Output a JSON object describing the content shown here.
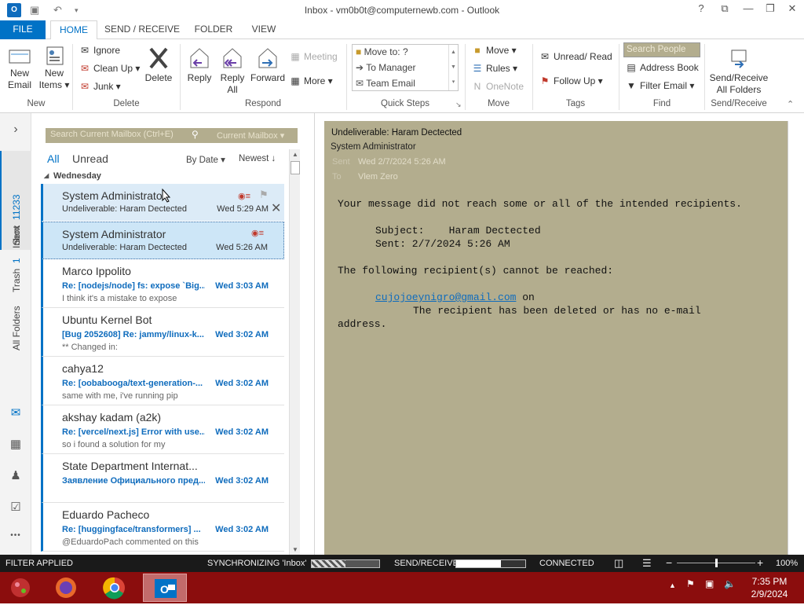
{
  "window": {
    "title": "Inbox - vm0b0t@computernewb.com - Outlook",
    "app_icon_label": "O",
    "controls": [
      "?",
      "⧉",
      "—",
      "❐",
      "✕"
    ]
  },
  "tabs": {
    "file": "FILE",
    "home": "HOME",
    "send_receive": "SEND / RECEIVE",
    "folder": "FOLDER",
    "view": "VIEW"
  },
  "ribbon": {
    "new": {
      "new_email_l1": "New",
      "new_email_l2": "Email",
      "new_items_l1": "New",
      "new_items_l2": "Items ▾",
      "label": "New"
    },
    "delete": {
      "ignore": "Ignore",
      "clean_up": "Clean Up ▾",
      "junk": "Junk ▾",
      "delete": "Delete",
      "label": "Delete"
    },
    "respond": {
      "reply": "Reply",
      "reply_all_l1": "Reply",
      "reply_all_l2": "All",
      "forward": "Forward",
      "meeting": "Meeting",
      "more": "More ▾",
      "label": "Respond"
    },
    "quick_steps": {
      "items": [
        "Move to: ?",
        "To Manager",
        "Team Email"
      ],
      "label": "Quick Steps"
    },
    "move": {
      "move": "Move ▾",
      "rules": "Rules ▾",
      "onenote": "OneNote",
      "label": "Move"
    },
    "tags": {
      "unread_read": "Unread/ Read",
      "follow_up": "Follow Up ▾",
      "label": "Tags"
    },
    "find": {
      "search_people_placeholder": "Search People",
      "address_book": "Address Book",
      "filter_email": "Filter Email ▾",
      "label": "Find"
    },
    "send_receive": {
      "l1": "Send/Receive",
      "l2": "All Folders",
      "label": "Send/Receive"
    }
  },
  "nav": {
    "inbox_label": "Inbox",
    "inbox_count": "11233",
    "sent_label": "Sent",
    "trash_label": "Trash",
    "trash_count": "1",
    "all_folders_label": "All Folders",
    "expand_glyph": "›",
    "more_glyph": "•••"
  },
  "list": {
    "search_placeholder": "Search Current Mailbox (Ctrl+E)",
    "search_scope": "Current Mailbox ▾",
    "filter_all": "All",
    "filter_unread": "Unread",
    "sort_by": "By Date ▾",
    "sort_order": "Newest ↓",
    "group": "Wednesday",
    "messages": [
      {
        "from": "System Administrator",
        "subject": "Undeliverable: Haram Dectected",
        "time": "Wed 5:29 AM",
        "preview": ""
      },
      {
        "from": "System Administrator",
        "subject": "Undeliverable: Haram Dectected",
        "time": "Wed 5:26 AM",
        "preview": ""
      },
      {
        "from": "Marco Ippolito",
        "subject": "Re: [nodejs/node] fs: expose `Big...",
        "time": "Wed 3:03 AM",
        "preview": "I think it's a mistake to expose"
      },
      {
        "from": "Ubuntu Kernel Bot",
        "subject": "[Bug 2052608] Re: jammy/linux-k...",
        "time": "Wed 3:02 AM",
        "preview": "** Changed in:"
      },
      {
        "from": "cahya12",
        "subject": "Re: [oobabooga/text-generation-...",
        "time": "Wed 3:02 AM",
        "preview": "same with me, i've running pip"
      },
      {
        "from": "akshay kadam (a2k)",
        "subject": "Re: [vercel/next.js] Error with use...",
        "time": "Wed 3:02 AM",
        "preview": "so i found a solution for my"
      },
      {
        "from": "State Department Internat...",
        "subject": "Заявление Официального пред...",
        "time": "Wed 3:02 AM",
        "preview": ""
      },
      {
        "from": "Eduardo Pacheco",
        "subject": "Re: [huggingface/transformers] ...",
        "time": "Wed 3:02 AM",
        "preview": "@EduardoPach commented on this"
      }
    ]
  },
  "reading": {
    "subject": "Undeliverable: Haram Dectected",
    "from": "System Administrator",
    "date": "Wed 2/7/2024 5:26 AM",
    "to": "Vlem Zero",
    "sent_label": "Sent",
    "to_label": "To",
    "body_line1": "Your message did not reach some or all of the intended recipients.",
    "body_subject_label": "Subject:",
    "body_subject_value": "Haram Dectected",
    "body_sent": "Sent: 2/7/2024 5:26 AM",
    "body_line2": "The following recipient(s) cannot be reached:",
    "recipient": "cujojoeynigro@gmail.com",
    "recipient_on": " on",
    "body_reason1": "The recipient has been deleted or has no e-mail",
    "body_reason2": "address."
  },
  "status": {
    "filter": "FILTER APPLIED",
    "sync": "SYNCHRONIZING  'Inbox'",
    "send_receive": "SEND/RECEIVE",
    "connected": "CONNECTED",
    "zoom": "100%",
    "sync_progress": 0.5,
    "send_receive_progress": 0.65,
    "zoom_slider": 0.5
  },
  "taskbar": {
    "time": "7:35 PM",
    "date": "2/9/2024"
  },
  "colors": {
    "accent": "#0072c6",
    "reading_bg": "#b3ad8e",
    "taskbar": "#8b0d0d"
  }
}
